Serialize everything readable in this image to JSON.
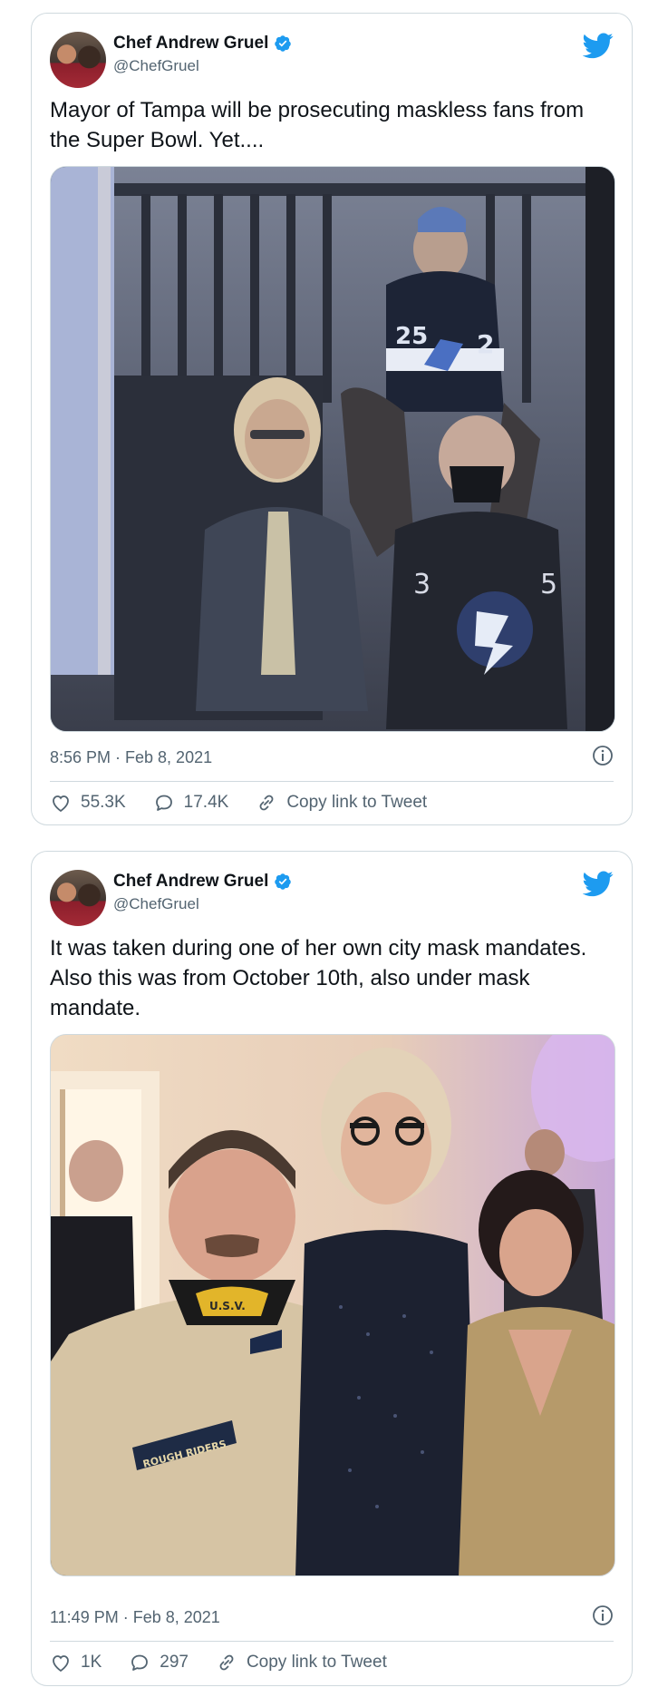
{
  "tweets": [
    {
      "author_name": "Chef Andrew Gruel",
      "handle": "@ChefGruel",
      "text": "Mayor of Tampa will be prosecuting maskless fans from the Super Bowl. Yet....",
      "timestamp": "8:56 PM · Feb 8, 2021",
      "likes": "55.3K",
      "replies": "17.4K",
      "copy_link": "Copy link to Tweet",
      "media": {
        "jersey_numbers": [
          "25",
          "2",
          "3",
          "5"
        ]
      }
    },
    {
      "author_name": "Chef Andrew Gruel",
      "handle": "@ChefGruel",
      "text": "It was taken during one of her own city mask mandates. Also this was from October 10th, also under mask mandate.",
      "timestamp": "11:49 PM · Feb 8, 2021",
      "likes": "1K",
      "replies": "297",
      "copy_link": "Copy link to Tweet",
      "media": {
        "patch_text": "ROUGH RIDERS",
        "collar_text": "U.S.V."
      }
    }
  ],
  "icons": {
    "verified": "verified-badge-icon",
    "bird": "twitter-bird-icon",
    "info": "info-icon",
    "like": "heart-icon",
    "reply": "reply-icon",
    "link": "link-icon"
  },
  "colors": {
    "brand_blue": "#1d9bf0",
    "text_primary": "#0f1419",
    "text_secondary": "#536471",
    "border": "#cfd9de"
  }
}
